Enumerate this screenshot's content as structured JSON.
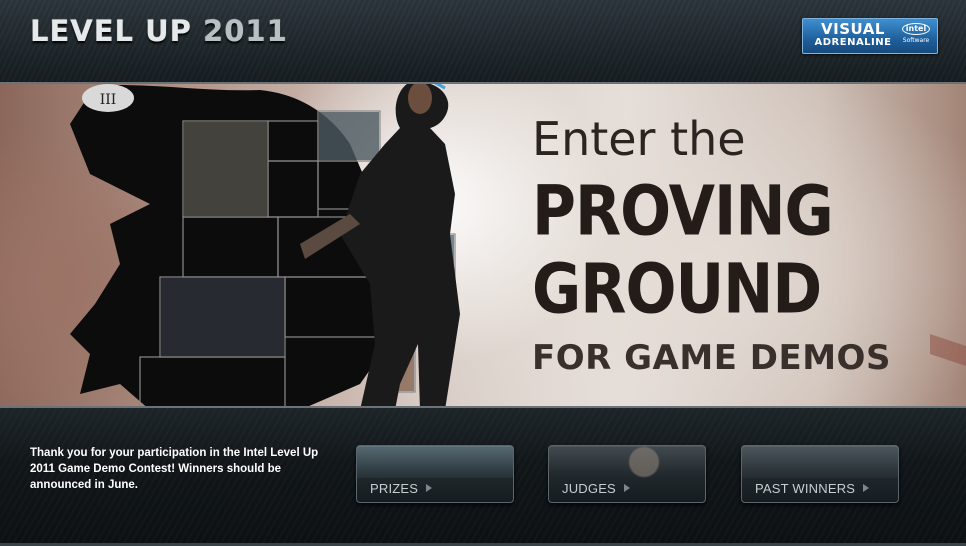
{
  "header": {
    "title_main": "LEVEL UP",
    "title_year": "2011",
    "badge": {
      "line1": "VISUAL",
      "line2": "ADRENALINE",
      "intel_logo": "intel",
      "intel_sub": "Software"
    }
  },
  "hero": {
    "line1": "Enter the",
    "line2": "PROVING",
    "line3": "GROUND",
    "line4": "FOR GAME DEMOS"
  },
  "footer": {
    "notice": "Thank you for your participation in the Intel Level Up 2011 Game Demo Contest! Winners should be announced in June.",
    "buttons": [
      {
        "label": "PRIZES"
      },
      {
        "label": "JUDGES"
      },
      {
        "label": "PAST WINNERS"
      }
    ]
  },
  "colors": {
    "header_bg": "#1f272c",
    "badge_blue": "#1f5f9c",
    "hero_text": "#231c19",
    "footer_bg": "#111619",
    "button_text": "#c7ced2"
  },
  "icons": [
    "arrow-right-icon",
    "intel-logo-icon"
  ]
}
